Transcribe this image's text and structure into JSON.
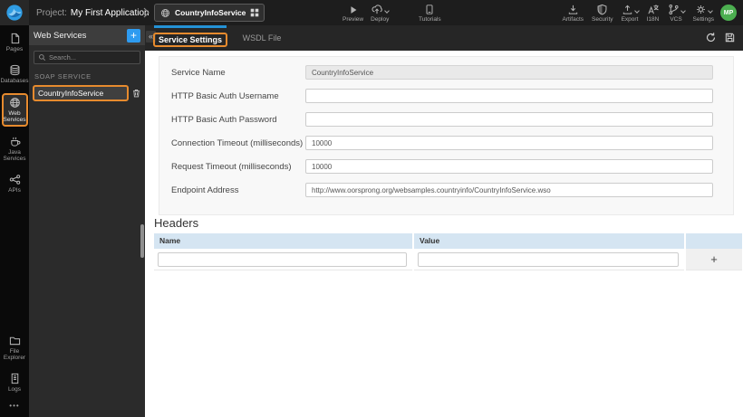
{
  "header": {
    "project_label": "Project:",
    "project_name": "My First Application",
    "breadcrumb": {
      "service_name": "CountryInfoService"
    },
    "toolbar": [
      {
        "label": "Preview"
      },
      {
        "label": "Deploy"
      },
      {
        "label": "Tutorials"
      },
      {
        "label": "Artifacts"
      },
      {
        "label": "Security"
      },
      {
        "label": "Export"
      },
      {
        "label": "I18N"
      },
      {
        "label": "VCS"
      },
      {
        "label": "Settings"
      }
    ],
    "avatar_initials": "MP"
  },
  "rail": {
    "items": [
      {
        "label": "Pages"
      },
      {
        "label": "Databases"
      },
      {
        "label": "Web Services"
      },
      {
        "label": "Java Services"
      },
      {
        "label": "APIs"
      },
      {
        "label": "File Explorer"
      },
      {
        "label": "Logs"
      }
    ],
    "more_dots": "•••"
  },
  "panel": {
    "title": "Web Services",
    "add_button": "+",
    "collapse_glyph": "«",
    "search_placeholder": "Search...",
    "section_label": "SOAP SERVICE",
    "service_item": "CountryInfoService"
  },
  "tabs": [
    {
      "label": "Service Settings",
      "active": true
    },
    {
      "label": "WSDL File",
      "active": false
    }
  ],
  "form": {
    "fields": [
      {
        "label": "Service Name",
        "value": "CountryInfoService",
        "disabled": true
      },
      {
        "label": "HTTP Basic Auth Username",
        "value": ""
      },
      {
        "label": "HTTP Basic Auth Password",
        "value": ""
      },
      {
        "label": "Connection Timeout (milliseconds)",
        "value": "10000"
      },
      {
        "label": "Request Timeout (milliseconds)",
        "value": "10000"
      },
      {
        "label": "Endpoint Address",
        "value": "http://www.oorsprong.org/websamples.countryinfo/CountryInfoService.wso"
      }
    ]
  },
  "headers_section": {
    "title": "Headers",
    "columns": [
      "Name",
      "Value"
    ],
    "row": {
      "name": "",
      "value": ""
    },
    "add_label": "+"
  },
  "colors": {
    "highlight_orange": "#e78b2e",
    "primary_blue": "#2e9bf0",
    "tab_accent_blue": "#2492d6",
    "avatar_green": "#4caf50",
    "table_header_blue": "#d5e5f2",
    "dark_header": "#1d1d1d",
    "panel_dark": "#2b2b2b"
  }
}
